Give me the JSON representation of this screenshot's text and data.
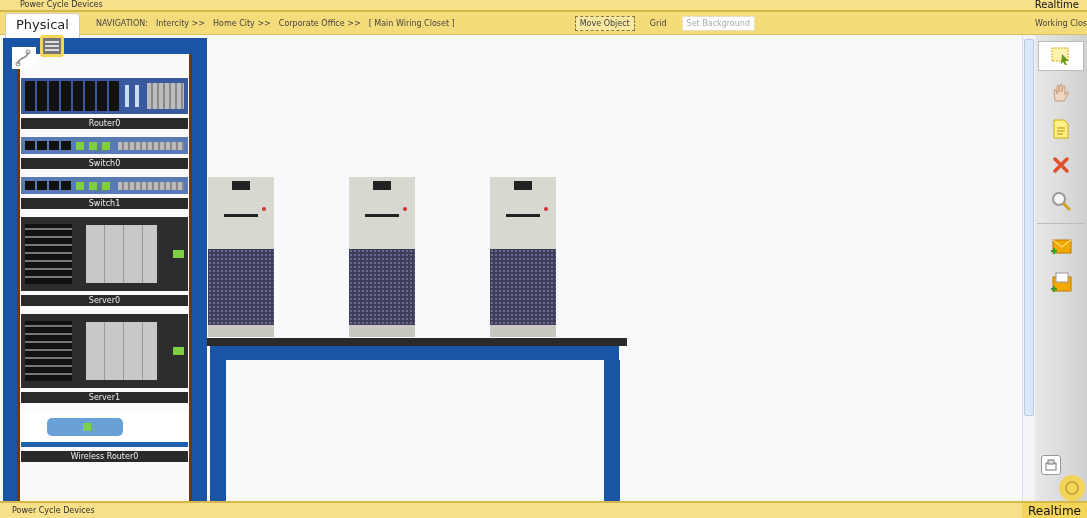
{
  "top_bar": {
    "action": "Power Cycle Devices",
    "mode": "Realtime"
  },
  "view_tab": {
    "label": "Physical",
    "selected": true
  },
  "navigation": {
    "label": "NAVIGATION:",
    "path": [
      "Intercity >>",
      "Home City >>",
      "Corporate Office >>",
      "[ Main Wiring Closet ]"
    ]
  },
  "nav_buttons": [
    {
      "label": "Move Object",
      "selected": true,
      "disabled": false
    },
    {
      "label": "Grid",
      "selected": false,
      "disabled": false
    },
    {
      "label": "Set Background",
      "selected": false,
      "disabled": true
    }
  ],
  "location": "Working Clos",
  "rack": {
    "devices": [
      {
        "kind": "router",
        "label": "Router0"
      },
      {
        "kind": "switch",
        "label": "Switch0"
      },
      {
        "kind": "switch",
        "label": "Switch1"
      },
      {
        "kind": "server",
        "label": "Server0"
      },
      {
        "kind": "server",
        "label": "Server1"
      },
      {
        "kind": "wireless-router",
        "label": "Wireless Router0"
      }
    ]
  },
  "table_devices": [
    {
      "kind": "pc"
    },
    {
      "kind": "pc"
    },
    {
      "kind": "pc"
    }
  ],
  "tools": [
    {
      "kind": "select",
      "selected": true
    },
    {
      "kind": "hand",
      "selected": false
    },
    {
      "kind": "note",
      "selected": false
    },
    {
      "kind": "delete",
      "selected": false
    },
    {
      "kind": "inspect",
      "selected": false
    },
    {
      "kind": "simple-pdu",
      "selected": false
    },
    {
      "kind": "complex-pdu",
      "selected": false
    }
  ],
  "bottom_bar": {
    "action": "Power Cycle Devices",
    "mode": "Realtime",
    "mode_selected": true
  }
}
